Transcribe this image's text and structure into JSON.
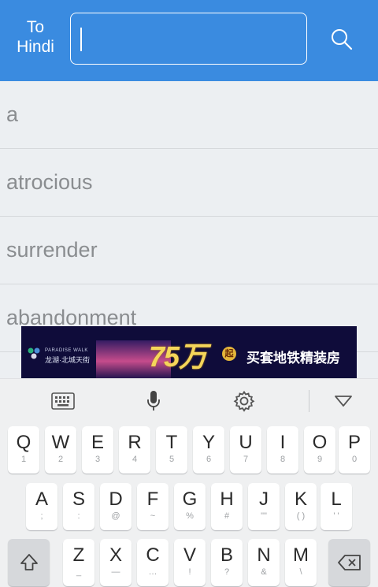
{
  "header": {
    "lang_line1": "To",
    "lang_line2": "Hindi",
    "search_value": ""
  },
  "words": [
    "a",
    "atrocious",
    "surrender",
    "abandonment"
  ],
  "ad": {
    "brand_small": "PARADISE WALK",
    "brand_name": "龙湖·北城天街",
    "price": "75万",
    "price_suffix": "起",
    "slogan": "买套地铁精装房"
  },
  "keyboard": {
    "row1": [
      {
        "k": "Q",
        "s": "1"
      },
      {
        "k": "W",
        "s": "2"
      },
      {
        "k": "E",
        "s": "3"
      },
      {
        "k": "R",
        "s": "4"
      },
      {
        "k": "T",
        "s": "5"
      },
      {
        "k": "Y",
        "s": "6"
      },
      {
        "k": "U",
        "s": "7"
      },
      {
        "k": "I",
        "s": "8"
      },
      {
        "k": "O",
        "s": "9"
      },
      {
        "k": "P",
        "s": "0"
      }
    ],
    "row2": [
      {
        "k": "A",
        "s": ";"
      },
      {
        "k": "S",
        "s": ":"
      },
      {
        "k": "D",
        "s": "@"
      },
      {
        "k": "F",
        "s": "~"
      },
      {
        "k": "G",
        "s": "%"
      },
      {
        "k": "H",
        "s": "#"
      },
      {
        "k": "J",
        "s": "\"\""
      },
      {
        "k": "K",
        "s": "( )"
      },
      {
        "k": "L",
        "s": "' '"
      }
    ],
    "row3": [
      {
        "k": "Z",
        "s": "_"
      },
      {
        "k": "X",
        "s": "—"
      },
      {
        "k": "C",
        "s": "…"
      },
      {
        "k": "V",
        "s": "!"
      },
      {
        "k": "B",
        "s": "?"
      },
      {
        "k": "N",
        "s": "&"
      },
      {
        "k": "M",
        "s": "\\"
      }
    ]
  }
}
